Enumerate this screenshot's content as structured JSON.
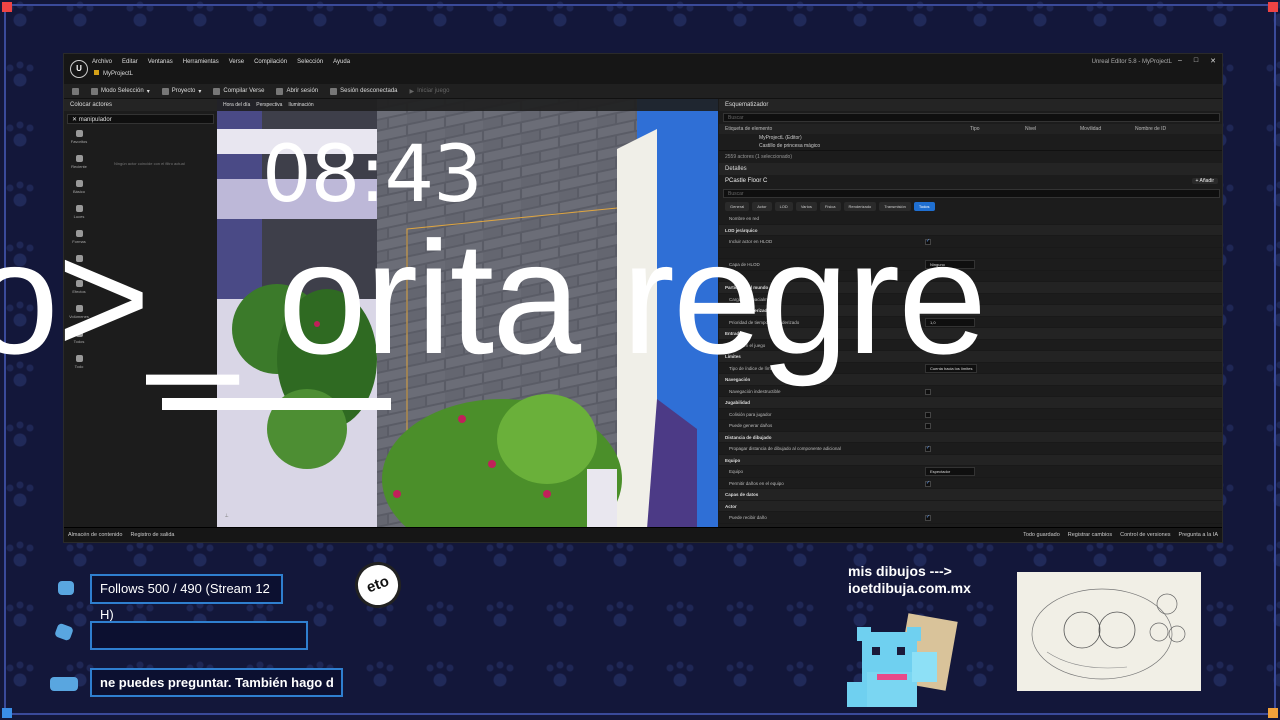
{
  "editor": {
    "menus": [
      "Archivo",
      "Editar",
      "Ventanas",
      "Herramientas",
      "Verse",
      "Compilación",
      "Selección",
      "Ayuda"
    ],
    "project_tab": "MyProjectL",
    "window_title": "Unreal Editor 5.8 - MyProjectL",
    "toolbar": {
      "mode": "Modo Selección",
      "project": "Proyecto",
      "compile": "Compilar Verse",
      "open_session": "Abrir sesión",
      "session_status": "Sesión desconectada",
      "start_game": "Iniciar juego"
    },
    "left_panel": {
      "tab": "Colocar actores",
      "search_value": "manipulador",
      "no_results": "Ningún actor coincide con el filtro actual",
      "categories": [
        "Favoritos",
        "Reciente",
        "Básico",
        "Luces",
        "Formas",
        "",
        "Efectos",
        "Volúmenes",
        "Todos",
        "Todo"
      ]
    },
    "viewport_toolbar": [
      "Hora del día",
      "Perspectiva",
      "Iluminación"
    ],
    "outliner": {
      "tab": "Esquematizador",
      "search_placeholder": "Buscar",
      "columns": [
        "Etiqueta de elemento",
        "Tipo",
        "Nivel",
        "Movilidad",
        "Nombre de ID"
      ],
      "rows": [
        "MyProjectL (Editor)",
        "Castillo de princesa mágico"
      ],
      "actor_count": "2559 actores (1 seleccionado)"
    },
    "details": {
      "tab": "Detalles",
      "actor_name": "PCastle Floor C",
      "add_label": "+ Añadir",
      "search_placeholder": "Buscar",
      "filters": [
        "General",
        "Actor",
        "LOD",
        "Varios",
        "Física",
        "Renderizado",
        "Transmisión",
        "Todos"
      ],
      "properties": [
        {
          "label": "Nombre en red",
          "type": "text"
        },
        {
          "label": "LOD jerárquico",
          "type": "section"
        },
        {
          "label": "Incluir actor en HLOD",
          "type": "check",
          "on": true
        },
        {
          "label": "",
          "type": "blank"
        },
        {
          "label": "Capa de HLOD",
          "type": "dropdown",
          "value": "Ninguno"
        },
        {
          "label": "",
          "type": "blank"
        },
        {
          "label": "Partición del mundo",
          "type": "section"
        },
        {
          "label": "Cargado espacialmente",
          "type": "text"
        },
        {
          "label": "Actor de renderizado",
          "type": "section"
        },
        {
          "label": "Prioridad de tiempo de renderizado",
          "type": "dropdown",
          "value": "1,0"
        },
        {
          "label": "Entrada",
          "type": "section"
        },
        {
          "label": "Oculto en el juego",
          "type": "check",
          "on": false
        },
        {
          "label": "Límites",
          "type": "section"
        },
        {
          "label": "Tipo de índice de límites",
          "type": "dropdown",
          "value": "Cuenta hacia los límites"
        },
        {
          "label": "Navegación",
          "type": "section"
        },
        {
          "label": "Navegación indestructible",
          "type": "check",
          "on": false
        },
        {
          "label": "Jugabilidad",
          "type": "section"
        },
        {
          "label": "Colisión para jugador",
          "type": "check",
          "on": false
        },
        {
          "label": "Puede generar daños",
          "type": "check",
          "on": false
        },
        {
          "label": "Distancia de dibujado",
          "type": "section"
        },
        {
          "label": "Propagar distancia de dibujado al componente adicional",
          "type": "check",
          "on": true
        },
        {
          "label": "Equipo",
          "type": "section"
        },
        {
          "label": "Equipo",
          "type": "dropdown",
          "value": "Espectador"
        },
        {
          "label": "Permitir daños en el equipo",
          "type": "check",
          "on": true
        },
        {
          "label": "Capas de datos",
          "type": "section"
        },
        {
          "label": "Actor",
          "type": "section"
        },
        {
          "label": "Puede recibir daño",
          "type": "check",
          "on": true
        }
      ]
    },
    "statusbar": {
      "content": "Almacén de contenido",
      "log": "Registro de salida",
      "saved": "Todo guardado",
      "changes": "Registrar cambios",
      "vcs": "Control de versiones",
      "ai": "Pregunta a la IA"
    }
  },
  "overlay": {
    "clock": "08:43",
    "marquee": "o>_ orita regre"
  },
  "stream": {
    "follows": "Follows 500 / 490 (Stream 12 H)",
    "chat2": "",
    "ticker": "ne puedes preguntar. También hago d",
    "logo_text": "eto",
    "promo_line1": "mis dibujos --->",
    "promo_line2": "ioetdibuja.com.mx"
  },
  "colors": {
    "accent": "#2f7fcf",
    "frame": "#3a4a9a",
    "background": "#13173a"
  }
}
